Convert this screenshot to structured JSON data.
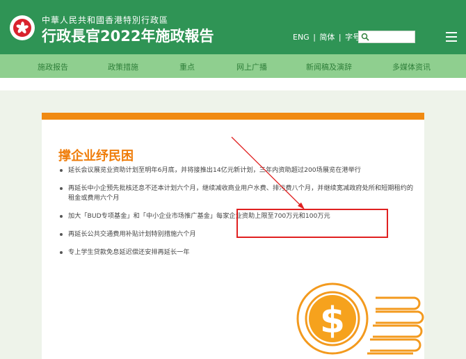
{
  "header": {
    "subtitle": "中華人民共和國香港特別行政區",
    "title": "行政長官2022年施政報告",
    "lang_eng": "ENG",
    "lang_sep1": "|",
    "lang_simplified": "简体",
    "lang_sep2": "|",
    "lang_fontsize": "字号",
    "search_placeholder": ""
  },
  "nav": {
    "items": [
      {
        "label": "施政报告"
      },
      {
        "label": "政策措施"
      },
      {
        "label": "重点"
      },
      {
        "label": "网上广播"
      },
      {
        "label": "新闻稿及演辞"
      },
      {
        "label": "多媒体资讯"
      }
    ]
  },
  "content": {
    "section_title": "撑企业纾民困",
    "bullets": [
      "延长会议展览业资助计划至明年6月底，并将接推出14亿元新计划，三年内资助超过200场展览在港举行",
      "再延长中小企预先批核还息不还本计划六个月，继续减收商业用户水费、排污费八个月，并继续宽减政府处所和短期租约的租金或费用六个月",
      "加大「BUD专项基金」和「中小企业市场推广基金」每家企业资助上限至700万元和100万元",
      "再延长公共交通费用补贴计划特别措施六个月",
      "专上学生贷款免息延迟偿还安排再延长一年"
    ]
  },
  "colors": {
    "header_green": "#2f9455",
    "nav_green": "#8fcf8f",
    "accent_orange": "#f08a12",
    "highlight_red": "#e02020"
  },
  "icons": {
    "emblem": "hksar-bauhinia-emblem",
    "search": "search-icon",
    "menu": "hamburger-menu-icon",
    "illustration": "dollar-coins-illustration"
  }
}
